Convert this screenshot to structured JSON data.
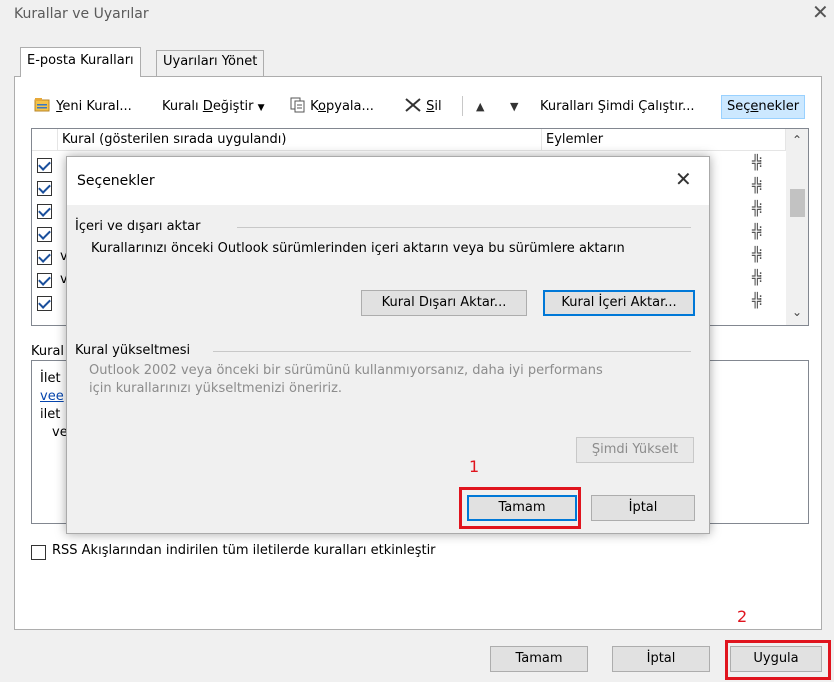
{
  "window": {
    "title": "Kurallar ve Uyarılar",
    "close_glyph": "✕"
  },
  "tabs": [
    {
      "label": "E-posta Kuralları"
    },
    {
      "label": "Uyarıları Yönet"
    }
  ],
  "toolbar": {
    "new_rule_pre": "",
    "new_rule_ul": "Y",
    "new_rule_post": "eni Kural...",
    "change_rule_pre": "Kuralı ",
    "change_rule_ul": "D",
    "change_rule_post": "eğiştir",
    "copy_pre": "K",
    "copy_ul": "o",
    "copy_post": "pyala...",
    "delete_ul": "S",
    "delete_post": "il",
    "run_rules": "Kuralları Şimdi Çalıştır...",
    "options_pre": "Seç",
    "options_ul": "e",
    "options_post": "nekler"
  },
  "rules_list": {
    "col_rule": "Kural (gösterilen sırada uygulandı)",
    "col_actions": "Eylemler",
    "rows": [
      {
        "checked": true
      },
      {
        "checked": true
      },
      {
        "checked": true
      },
      {
        "checked": true
      },
      {
        "checked": true
      },
      {
        "checked": true
      },
      {
        "checked": true
      }
    ],
    "row_letters": [
      "",
      "",
      "",
      "",
      "v",
      "v",
      ""
    ]
  },
  "description": {
    "label": "Kural",
    "lines": [
      "İlet",
      "vee",
      "ilet",
      "ve"
    ]
  },
  "rss_checkbox": {
    "label": "RSS Akışlarından indirilen tüm iletilerde kuralları etkinleştir",
    "checked": false
  },
  "footer": {
    "ok": "Tamam",
    "cancel": "İptal",
    "apply": "Uygula"
  },
  "dialog": {
    "title": "Seçenekler",
    "close_glyph": "✕",
    "import_export": {
      "group_label": "İçeri ve dışarı aktar",
      "text": "Kurallarınızı önceki Outlook sürümlerinden içeri aktarın veya bu sürümlere aktarın",
      "export_button": "Kural Dışarı Aktar...",
      "import_button": "Kural İçeri Aktar..."
    },
    "upgrade": {
      "group_label": "Kural yükseltmesi",
      "line1": "Outlook 2002 veya önceki bir sürümünü kullanmıyorsanız, daha iyi performans",
      "line2": "için kurallarınızı yükseltmenizi öneririz.",
      "upgrade_button": "Şimdi Yükselt"
    },
    "ok": "Tamam",
    "cancel": "İptal"
  },
  "annotations": {
    "marker_1": "1",
    "marker_2": "2",
    "highlight_color": "#e0141e"
  }
}
